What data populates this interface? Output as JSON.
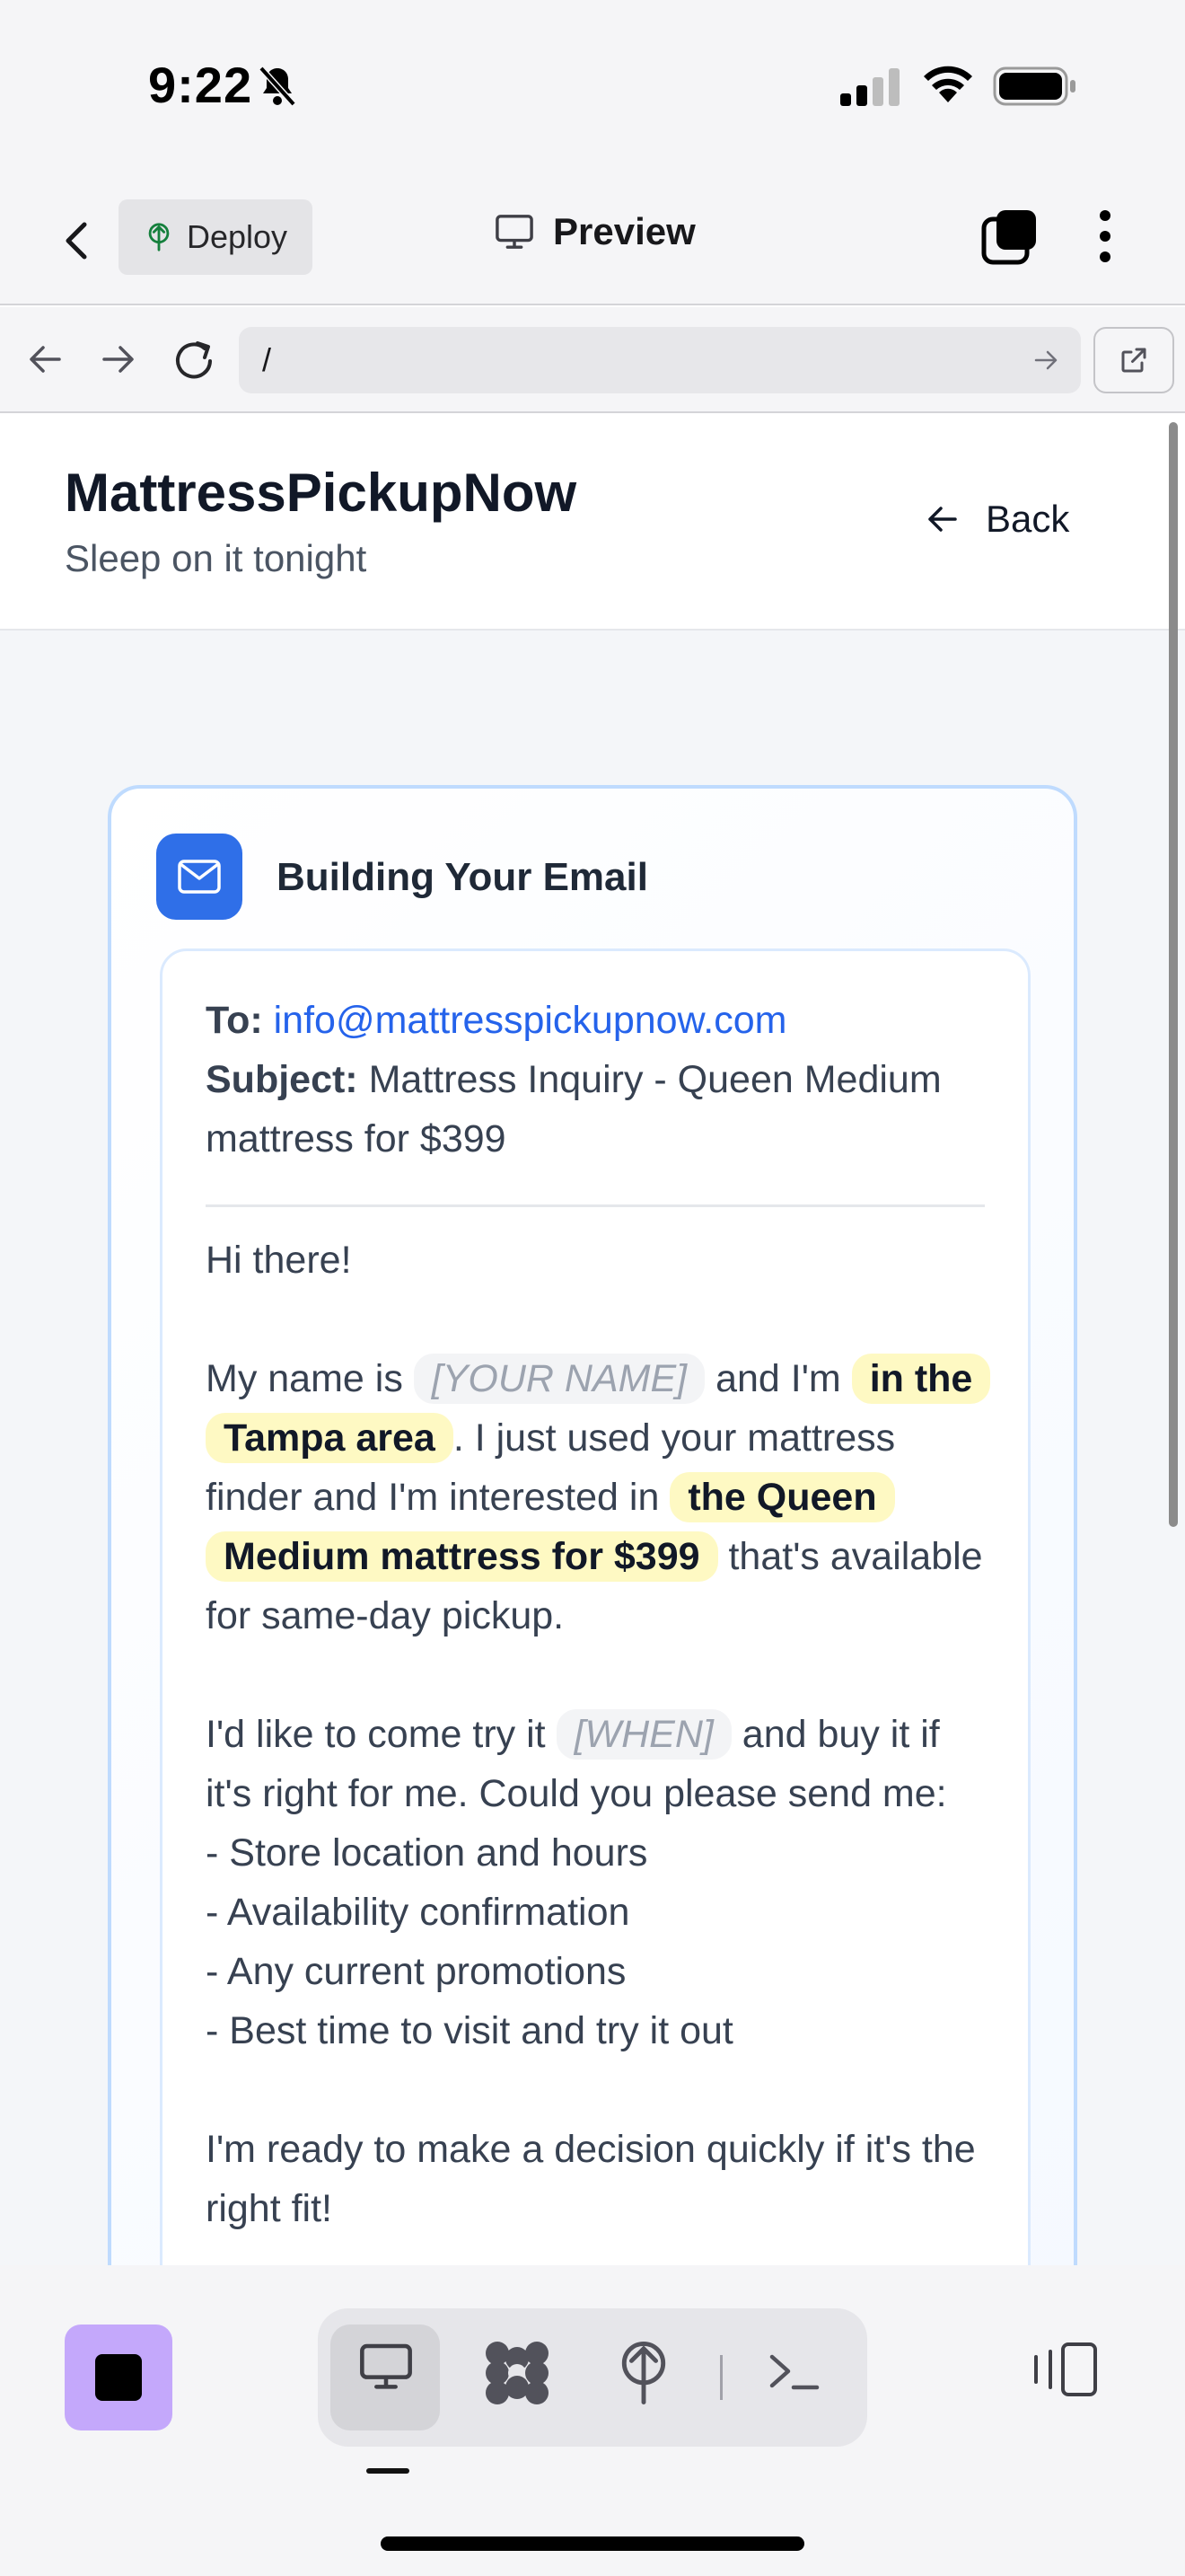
{
  "status_bar": {
    "time": "9:22"
  },
  "app_header": {
    "deploy_label": "Deploy",
    "preview_label": "Preview"
  },
  "url_bar": {
    "url": "/"
  },
  "site": {
    "brand": "MattressPickupNow",
    "tagline": "Sleep on it tonight",
    "back_label": "Back"
  },
  "email_card": {
    "title": "Building Your Email",
    "to_label": "To:",
    "to_value": "info@mattresspickupnow.com",
    "subject_label": "Subject:",
    "subject_value": "Mattress Inquiry - Queen Medium mattress for $399",
    "greeting": "Hi there!",
    "p1_a": "My name is",
    "p1_name_placeholder": "[YOUR NAME]",
    "p1_b": "and I'm",
    "p1_location": "in the Tampa area",
    "p1_c": ". I just used your mattress finder and I'm interested in",
    "p1_mattress": "the Queen Medium mattress for $399",
    "p1_d": "that's available for same-day pickup.",
    "p2_a": "I'd like to come try it",
    "p2_when_placeholder": "[WHEN]",
    "p2_b": "and buy it if it's right for me. Could you please send me:",
    "list": [
      "- Store location and hours",
      "- Availability confirmation",
      "- Any current promotions",
      "- Best time to visit and try it out"
    ],
    "closing": "I'm ready to make a decision quickly if it's the right fit!"
  },
  "icons": {
    "accent_purple": "#c4a8fb",
    "accent_blue": "#2f6fe8",
    "highlight_yellow": "#fef9c3"
  }
}
